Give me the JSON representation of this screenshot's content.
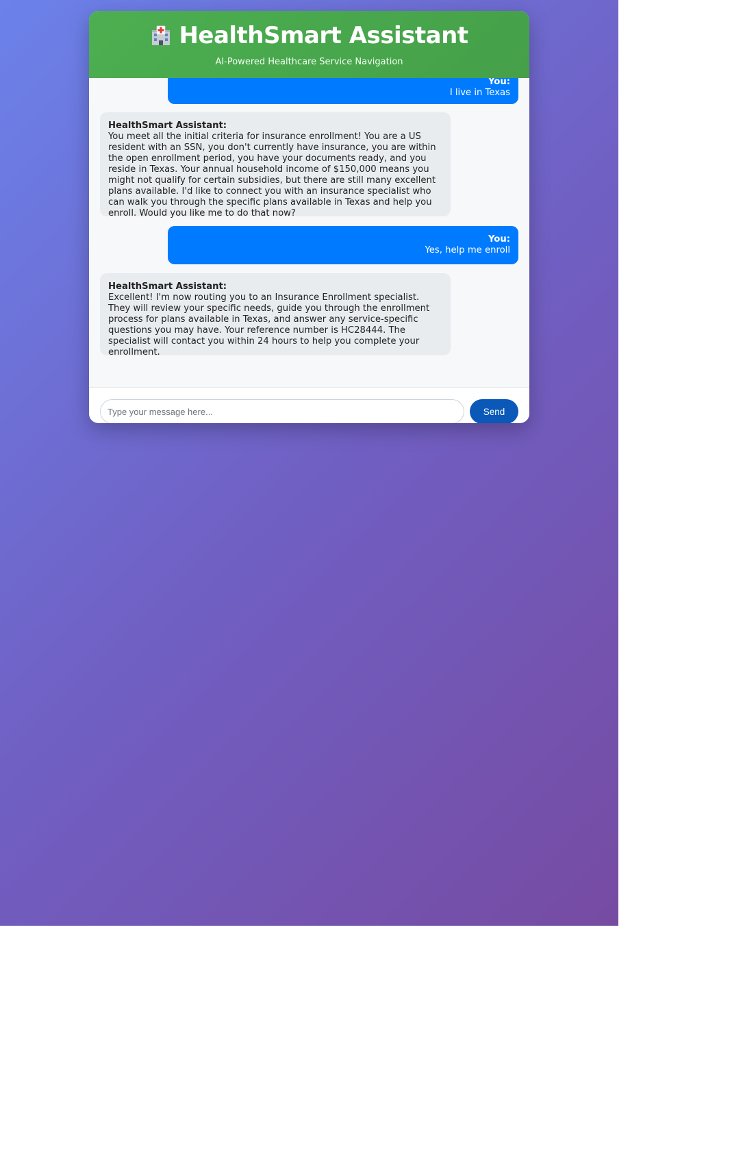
{
  "header": {
    "icon": "hospital-icon",
    "title": "HealthSmart Assistant",
    "subtitle": "AI-Powered Healthcare Service Navigation"
  },
  "messages": [
    {
      "role": "user",
      "sender": "You:",
      "text": "I live in Texas"
    },
    {
      "role": "assistant",
      "sender": "HealthSmart Assistant:",
      "text": "You meet all the initial criteria for insurance enrollment! You are a US resident with an SSN, you don't currently have insurance, you are within the open enrollment period, you have your documents ready, and you reside in Texas. Your annual household income of $150,000 means you might not qualify for certain subsidies, but there are still many excellent plans available. I'd like to connect you with an insurance specialist who can walk you through the specific plans available in Texas and help you enroll. Would you like me to do that now?"
    },
    {
      "role": "user",
      "sender": "You:",
      "text": "Yes, help me enroll"
    },
    {
      "role": "assistant",
      "sender": "HealthSmart Assistant:",
      "text": "Excellent! I'm now routing you to an Insurance Enrollment specialist. They will review your specific needs, guide you through the enrollment process for plans available in Texas, and answer any service-specific questions you may have. Your reference number is HC28444. The specialist will contact you within 24 hours to help you complete your enrollment."
    }
  ],
  "input": {
    "placeholder": "Type your message here...",
    "value": ""
  },
  "send_button": {
    "label": "Send"
  },
  "colors": {
    "header": "#4caf50",
    "user_bubble": "#007bff",
    "assistant_bubble": "#e9ecef",
    "send_button": "#0a58b8",
    "background_start": "#6b82ea",
    "background_end": "#764ba2"
  }
}
